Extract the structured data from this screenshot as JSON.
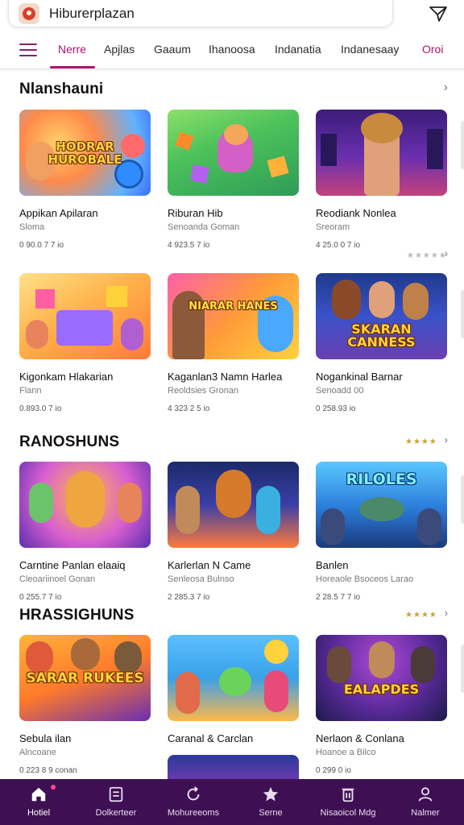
{
  "app": {
    "title": "Hiburerplazan"
  },
  "tabs": [
    {
      "label": "Nerre",
      "active": true
    },
    {
      "label": "Apjlas"
    },
    {
      "label": "Gaaum"
    },
    {
      "label": "Ihanoosa"
    },
    {
      "label": "Indanatia"
    },
    {
      "label": "Indanesaay"
    },
    {
      "label": "Oroi"
    }
  ],
  "sections": [
    {
      "title": "Nlanshauni",
      "more_icon": "chevron-right-icon",
      "rows": [
        [
          {
            "name": "Appikan Apilaran",
            "sub": "Sloma",
            "meta": "0 90.0 7 7 io",
            "thumb_text": "HODRAR HUROBALE"
          },
          {
            "name": "Riburan Hib",
            "sub": "Senoanda Goman",
            "meta": "4 923.5 7 io",
            "thumb_text": ""
          },
          {
            "name": "Reodiank Nonlea",
            "sub": "Sreoram",
            "meta": "4 25.0 0 7 io",
            "thumb_text": ""
          }
        ],
        [
          {
            "name": "Kigonkam Hlakarian",
            "sub": "Flann",
            "meta": "0.893.0 7 io",
            "thumb_text": ""
          },
          {
            "name": "Kaganlan3 Namn Harlea",
            "sub": "Reoldsies Gronan",
            "meta": "4 323 2 5 io",
            "thumb_text": "NIARAR HANES"
          },
          {
            "name": "Nogankinal Barnar",
            "sub": "Senoadd 00",
            "meta": "0 258.93 io",
            "thumb_text": "SKARAN CANNESS"
          }
        ]
      ],
      "row_stars": [
        "★★★★★"
      ]
    },
    {
      "title": "RANOSHUNS",
      "stars": "★★★★",
      "rows": [
        [
          {
            "name": "Carntine Panlan elaaiq",
            "sub": "Cleoariinoel Gonan",
            "meta": "0 255.7 7 io",
            "thumb_text": ""
          },
          {
            "name": "Karlerlan N Came",
            "sub": "Senleosa Bulnso",
            "meta": "2 285.3 7 io",
            "thumb_text": ""
          },
          {
            "name": "Banlen",
            "sub": "Horeaole Bsoceos Larao",
            "meta": "2 28.5 7 7 io",
            "thumb_text": "RILOLES"
          }
        ]
      ]
    },
    {
      "title": "HRASSIGHUNS",
      "stars": "★★★★",
      "rows": [
        [
          {
            "name": "Sebula ilan",
            "sub": "Alncoane",
            "meta": "0 223 8 9 conan",
            "thumb_text": "SARAR RUKEES"
          },
          {
            "name": "Caranal & Carclan",
            "sub": "",
            "meta": "",
            "thumb_text": ""
          },
          {
            "name": "Nerlaon & Conlana",
            "sub": "Hoanoe a Bilco",
            "meta": "0 299 0 io",
            "thumb_text": "EALAPDES"
          }
        ]
      ]
    }
  ],
  "bottom_nav": [
    {
      "label": "Hotiel",
      "icon": "home-icon",
      "active": true
    },
    {
      "label": "Dolkerteer",
      "icon": "document-icon"
    },
    {
      "label": "Mohureeoms",
      "icon": "refresh-icon"
    },
    {
      "label": "Serne",
      "icon": "star-icon"
    },
    {
      "label": "Nisaoicol Mdg",
      "icon": "trash-icon"
    },
    {
      "label": "Nalmer",
      "icon": "profile-icon"
    }
  ],
  "colors": {
    "accent": "#b3126b",
    "nav_bg": "#3e0f52",
    "star": "#c9a23a"
  }
}
